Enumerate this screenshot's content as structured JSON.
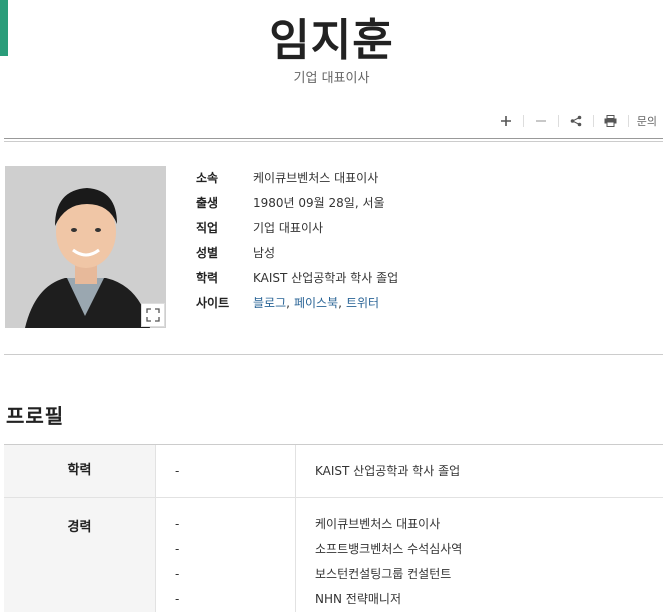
{
  "header": {
    "name": "임지훈",
    "subtitle": "기업 대표이사",
    "accent_color": "#2a9d7a"
  },
  "toolbar": {
    "icons": [
      "plus-icon",
      "minus-icon",
      "share-icon",
      "print-icon"
    ],
    "inquiry_label": "문의"
  },
  "info": {
    "rows": [
      {
        "key": "소속",
        "value": "케이큐브벤처스 대표이사"
      },
      {
        "key": "출생",
        "value": "1980년 09월 28일, 서울"
      },
      {
        "key": "직업",
        "value": "기업 대표이사"
      },
      {
        "key": "성별",
        "value": "남성"
      },
      {
        "key": "학력",
        "value": "KAIST 산업공학과 학사 졸업"
      }
    ],
    "site_key": "사이트",
    "site_links": [
      "블로그",
      "페이스북",
      "트위터"
    ],
    "link_color": "#2a6496"
  },
  "profile": {
    "title": "프로필",
    "education": {
      "head": "학력",
      "dash": "-",
      "value": "KAIST 산업공학과 학사 졸업"
    },
    "career": {
      "head": "경력",
      "items": [
        {
          "dash": "-",
          "value": "케이큐브벤처스 대표이사"
        },
        {
          "dash": "-",
          "value": "소프트뱅크벤처스 수석심사역"
        },
        {
          "dash": "-",
          "value": "보스턴컨설팅그룹 컨설턴트"
        },
        {
          "dash": "-",
          "value": "NHN 전략매니저"
        }
      ]
    }
  }
}
